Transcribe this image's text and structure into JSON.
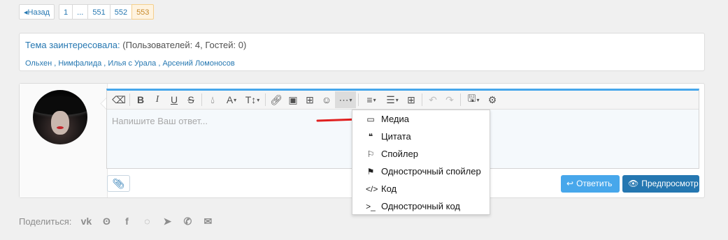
{
  "pagination": {
    "prev_label": "◂Назад",
    "pages": [
      "1",
      "...",
      "551",
      "552",
      "553"
    ],
    "current": "553"
  },
  "viewers": {
    "title_link": "Тема заинтересовала:",
    "title_counts": " (Пользователей: 4, Гостей: 0)",
    "names": "Ольхен , Нимфалида , Илья с Урала , Арсений Ломоносов"
  },
  "editor": {
    "placeholder": "Напишите Ваш ответ...",
    "toolbar_icons": [
      "eraser-icon",
      "bold-icon",
      "italic-icon",
      "underline-icon",
      "strikethrough-icon",
      "color-icon",
      "font-family-icon",
      "font-size-icon",
      "link-icon",
      "image-icon",
      "media-icon",
      "smilie-icon",
      "more-icon",
      "align-icon",
      "list-icon",
      "table-icon",
      "undo-icon",
      "redo-icon",
      "drafts-icon",
      "settings-icon"
    ]
  },
  "buttons": {
    "reply": "Ответить",
    "preview": "Предпросмотр"
  },
  "insert_menu": {
    "items": [
      "Медиа",
      "Цитата",
      "Спойлер",
      "Однострочный спойлер",
      "Код",
      "Однострочный код"
    ]
  },
  "share": {
    "label": "Поделиться:",
    "networks": [
      "vk-icon",
      "odnoklassniki-icon",
      "facebook-icon",
      "whatsapp-icon",
      "telegram-icon",
      "viber-icon",
      "email-icon"
    ]
  },
  "colors": {
    "accent": "#47a7eb",
    "link": "#2577b1",
    "primary_button": "#2577b1",
    "annotation_arrow": "#e02020"
  }
}
